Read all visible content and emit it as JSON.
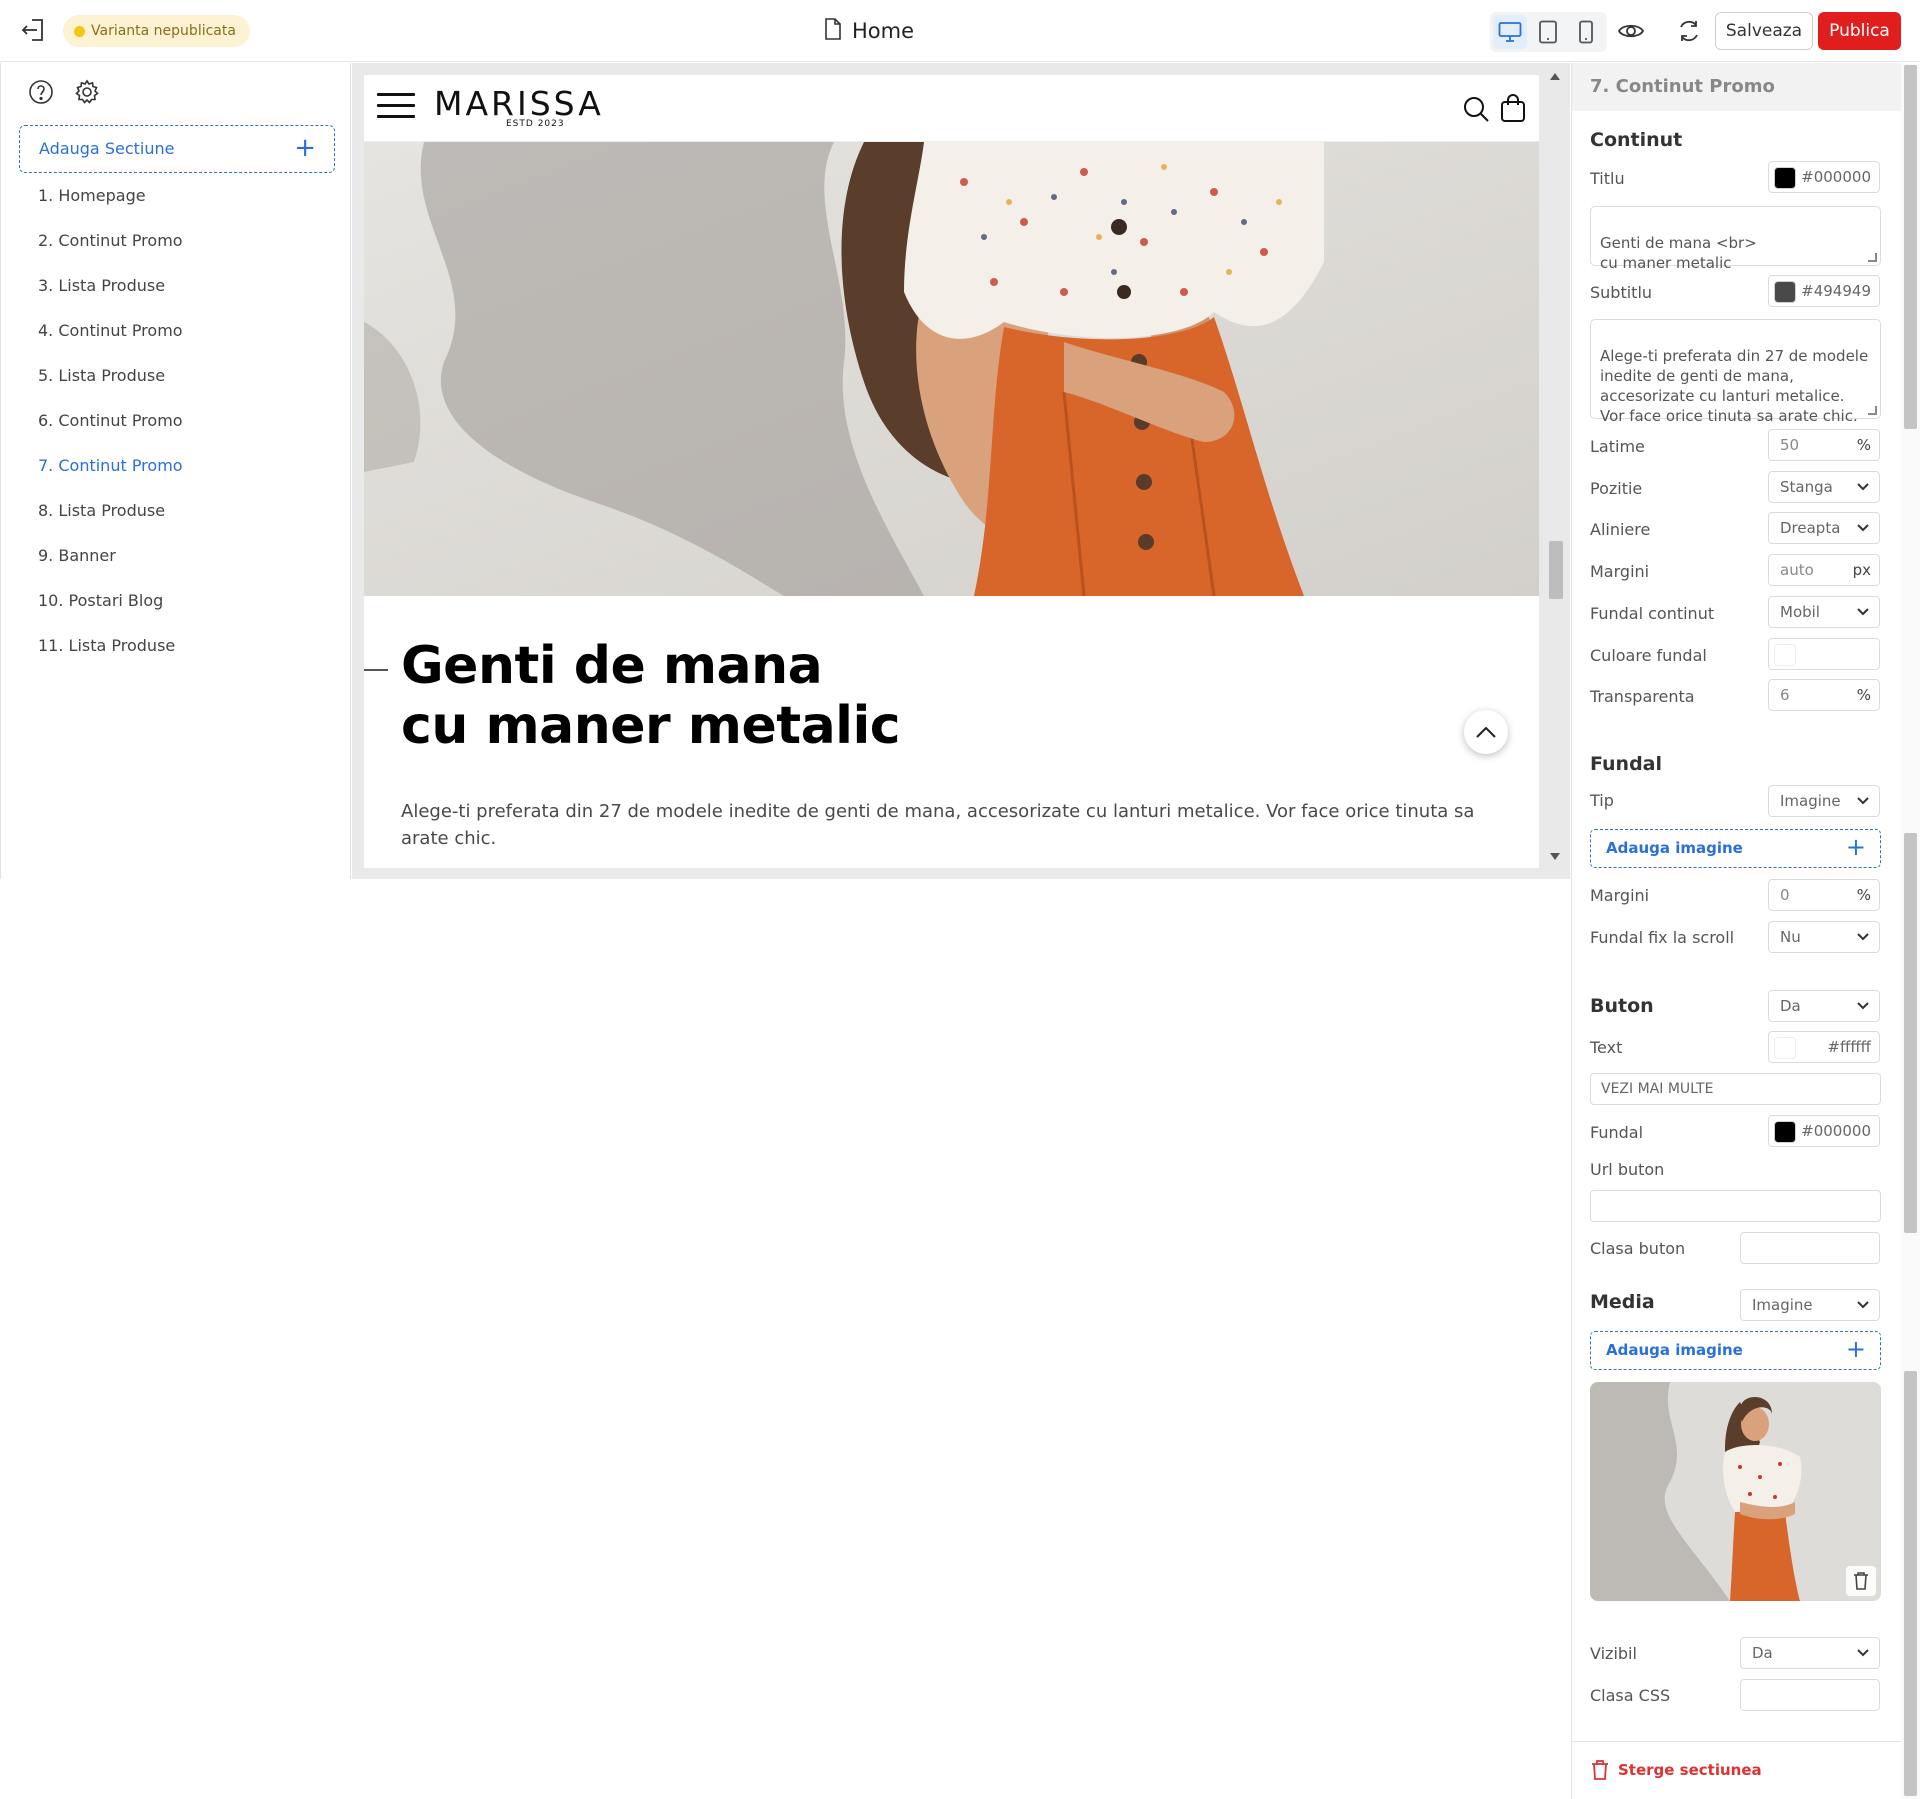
{
  "topbar": {
    "status": "Varianta nepublicata",
    "page_title": "Home",
    "save_label": "Salveaza",
    "publish_label": "Publica"
  },
  "sidebar": {
    "add_section_label": "Adauga Sectiune",
    "items": [
      {
        "label": "1. Homepage"
      },
      {
        "label": "2. Continut Promo"
      },
      {
        "label": "3. Lista Produse"
      },
      {
        "label": "4. Continut Promo"
      },
      {
        "label": "5. Lista Produse"
      },
      {
        "label": "6. Continut Promo"
      },
      {
        "label": "7. Continut Promo"
      },
      {
        "label": "8. Lista Produse"
      },
      {
        "label": "9. Banner"
      },
      {
        "label": "10. Postari Blog"
      },
      {
        "label": "11. Lista Produse"
      }
    ],
    "active_index": 6
  },
  "preview": {
    "logo": "MARISSA",
    "logo_sub": "ESTD 2023",
    "promo_title_line1": "Genti de mana",
    "promo_title_line2": "cu maner metalic",
    "promo_subtitle": "Alege-ti preferata din 27 de modele inedite de genti de mana, accesorizate cu lanturi metalice. Vor face orice tinuta sa arate chic."
  },
  "panel": {
    "header": "7. Continut Promo",
    "continut": {
      "section_title": "Continut",
      "titlu_label": "Titlu",
      "titlu_color": "#000000",
      "titlu_text": "Genti de mana <br>\ncu maner metalic",
      "subtitlu_label": "Subtitlu",
      "subtitlu_color": "#494949",
      "subtitlu_text": "Alege-ti preferata din 27 de modele inedite de genti de mana, accesorizate cu lanturi metalice. Vor face orice tinuta sa arate chic.",
      "latime_label": "Latime",
      "latime_value": "50",
      "latime_unit": "%",
      "pozitie_label": "Pozitie",
      "pozitie_value": "Stanga",
      "aliniere_label": "Aliniere",
      "aliniere_value": "Dreapta",
      "margini_label": "Margini",
      "margini_value": "auto",
      "margini_unit": "px",
      "fundal_continut_label": "Fundal continut",
      "fundal_continut_value": "Mobil",
      "culoare_fundal_label": "Culoare fundal",
      "transparenta_label": "Transparenta",
      "transparenta_value": "6",
      "transparenta_unit": "%"
    },
    "fundal": {
      "section_title": "Fundal",
      "tip_label": "Tip",
      "tip_value": "Imagine",
      "add_image_label": "Adauga imagine",
      "margini_label": "Margini",
      "margini_value": "0",
      "margini_unit": "%",
      "fix_label": "Fundal fix la scroll",
      "fix_value": "Nu"
    },
    "buton": {
      "section_title": "Buton",
      "buton_value": "Da",
      "text_label": "Text",
      "text_color": "#ffffff",
      "text_value": "VEZI MAI MULTE",
      "fundal_label": "Fundal",
      "fundal_color": "#000000",
      "url_label": "Url buton",
      "url_value": "",
      "clasa_label": "Clasa buton",
      "clasa_value": ""
    },
    "media": {
      "section_title": "Media",
      "media_value": "Imagine",
      "add_image_label": "Adauga imagine"
    },
    "vizibil_label": "Vizibil",
    "vizibil_value": "Da",
    "clasa_css_label": "Clasa CSS",
    "clasa_css_value": "",
    "delete_label": "Sterge sectiunea"
  },
  "colors": {
    "accent": "#2a6fdb",
    "publish": "#e01e1e",
    "status_dot": "#f5c518",
    "delete": "#e03131"
  },
  "icons": [
    "exit-icon",
    "page-icon",
    "desktop-icon",
    "tablet-icon",
    "mobile-icon",
    "eye-icon",
    "sync-icon",
    "help-icon",
    "gear-icon",
    "hamburger-icon",
    "search-icon",
    "bag-icon",
    "chevron-up-icon",
    "chevron-down-icon",
    "trash-icon",
    "plus-icon"
  ]
}
